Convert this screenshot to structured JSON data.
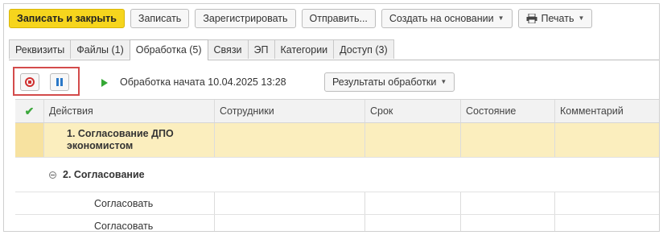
{
  "toolbar": {
    "save_close": "Записать и закрыть",
    "save": "Записать",
    "register": "Зарегистрировать",
    "send": "Отправить...",
    "create_based": "Создать на основании",
    "print": "Печать"
  },
  "tabs": [
    {
      "label": "Реквизиты"
    },
    {
      "label": "Файлы (1)"
    },
    {
      "label": "Обработка (5)"
    },
    {
      "label": "Связи"
    },
    {
      "label": "ЭП"
    },
    {
      "label": "Категории"
    },
    {
      "label": "Доступ (3)"
    }
  ],
  "active_tab": "Обработка (5)",
  "process": {
    "status": "Обработка начата 10.04.2025 13:28",
    "results_button": "Результаты обработки"
  },
  "table": {
    "headers": [
      "Действия",
      "Сотрудники",
      "Срок",
      "Состояние",
      "Комментарий"
    ],
    "rows": [
      {
        "action": "1. Согласование ДПО экономистом",
        "employee": "",
        "deadline": "",
        "state": "",
        "comment": ""
      },
      {
        "action": "2. Согласование",
        "employee": "",
        "deadline": "",
        "state": "",
        "comment": ""
      },
      {
        "action": "Согласовать",
        "employee": "",
        "deadline": "",
        "state": "",
        "comment": ""
      },
      {
        "action": "Согласовать",
        "employee": "",
        "deadline": "",
        "state": "",
        "comment": ""
      }
    ]
  },
  "icons": {
    "stop": "stop-icon",
    "pause": "pause-icon",
    "play": "play-icon",
    "check": "check-icon",
    "print": "printer-icon",
    "collapse": "collapse-icon"
  },
  "colors": {
    "primary_button": "#f6d51d",
    "highlight_box": "#d34b4b",
    "selected_row": "#fbeebe",
    "stop": "#d03030",
    "pause": "#2a78c8",
    "play": "#34a834"
  }
}
